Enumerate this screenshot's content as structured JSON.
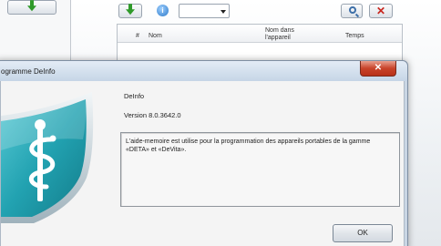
{
  "background": {
    "list_headers": {
      "number": "#",
      "name": "Nom",
      "device_name": "Nom dans l'appareil",
      "time": "Temps"
    },
    "info_icon": "info-icon",
    "icons": [
      "add-down-arrow-icon",
      "info-icon",
      "search-icon",
      "close-icon"
    ]
  },
  "dialog": {
    "title": "ogramme DeInfo",
    "close_label": "✕",
    "program_name": "DeInfo",
    "version": "Version 8.0.3642.0",
    "description": "L'aide-memoire est utilise pour la programmation des appareils portables de la gamme «DETA» et «DeVita».",
    "ok_label": "OK",
    "logo_icon": "medical-shield-icon"
  },
  "colors": {
    "shield_teal": "#2aa9b7",
    "close_red": "#c8432a",
    "accent_green": "#2f9a2a"
  }
}
